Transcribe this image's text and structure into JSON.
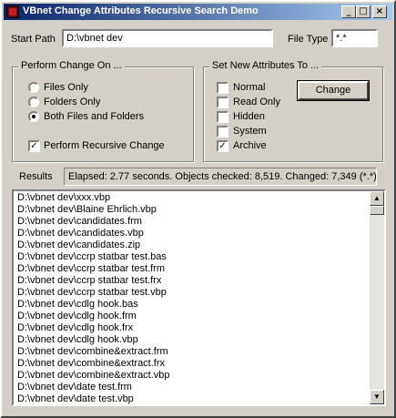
{
  "window": {
    "title": "VBnet Change Attributes Recursive Search Demo",
    "controls": {
      "minimize": "_",
      "maximize": "□",
      "close": "×"
    }
  },
  "start_path": {
    "label": "Start Path",
    "value": "D:\\vbnet dev"
  },
  "file_type": {
    "label": "File Type",
    "value": "*.*"
  },
  "perform_change_on": {
    "legend": "Perform Change On ...",
    "options": [
      {
        "label": "Files Only",
        "selected": false
      },
      {
        "label": "Folders Only",
        "selected": false
      },
      {
        "label": "Both Files and Folders",
        "selected": true
      }
    ],
    "recursive": {
      "label": "Perform Recursive Change",
      "checked": true
    }
  },
  "set_attributes": {
    "legend": "Set New Attributes To ...",
    "options": [
      {
        "label": "Normal",
        "checked": false
      },
      {
        "label": "Read Only",
        "checked": false
      },
      {
        "label": "Hidden",
        "checked": false
      },
      {
        "label": "System",
        "checked": false
      },
      {
        "label": "Archive",
        "checked": true
      }
    ],
    "change_button": "Change"
  },
  "results": {
    "label": "Results",
    "status": "Elapsed: 2.77 seconds.  Objects checked: 8,519.  Changed: 7,349 (*.*)",
    "items": [
      "D:\\vbnet dev\\xxx.vbp",
      "D:\\vbnet dev\\Blaine Ehrlich.vbp",
      "D:\\vbnet dev\\candidates.frm",
      "D:\\vbnet dev\\candidates.vbp",
      "D:\\vbnet dev\\candidates.zip",
      "D:\\vbnet dev\\ccrp statbar test.bas",
      "D:\\vbnet dev\\ccrp statbar test.frm",
      "D:\\vbnet dev\\ccrp statbar test.frx",
      "D:\\vbnet dev\\ccrp statbar test.vbp",
      "D:\\vbnet dev\\cdlg hook.bas",
      "D:\\vbnet dev\\cdlg hook.frm",
      "D:\\vbnet dev\\cdlg hook.frx",
      "D:\\vbnet dev\\cdlg hook.vbp",
      "D:\\vbnet dev\\combine&extract.frm",
      "D:\\vbnet dev\\combine&extract.frx",
      "D:\\vbnet dev\\combine&extract.vbp",
      "D:\\vbnet dev\\date test.frm",
      "D:\\vbnet dev\\date test.vbp"
    ]
  },
  "scrollbar": {
    "up": "▲",
    "down": "▼"
  }
}
